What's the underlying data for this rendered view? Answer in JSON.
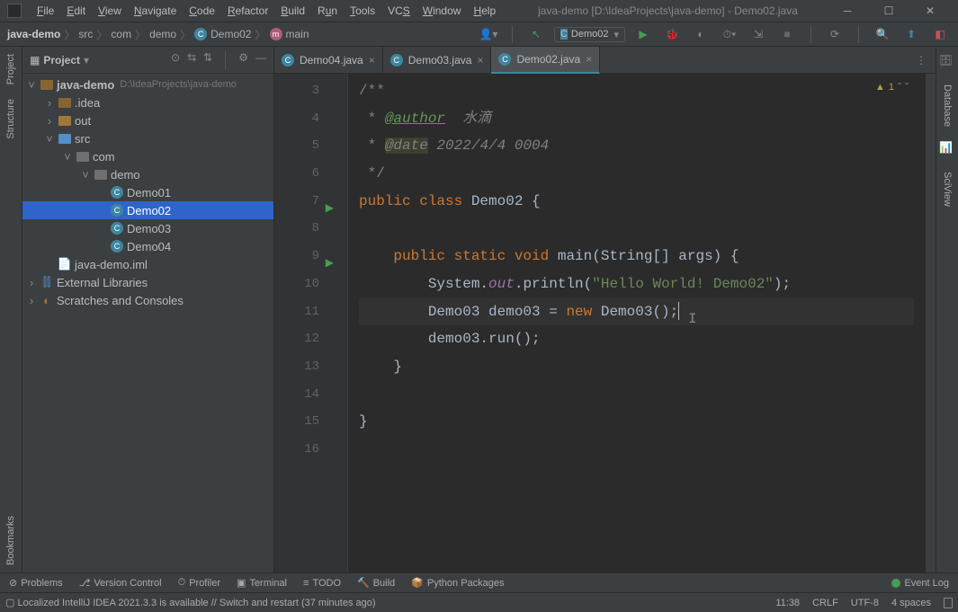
{
  "titlebar": {
    "menus": [
      "File",
      "Edit",
      "View",
      "Navigate",
      "Code",
      "Refactor",
      "Build",
      "Run",
      "Tools",
      "VCS",
      "Window",
      "Help"
    ],
    "title": "java-demo [D:\\IdeaProjects\\java-demo] - Demo02.java"
  },
  "breadcrumb": {
    "items": [
      "java-demo",
      "src",
      "com",
      "demo",
      "Demo02",
      "main"
    ]
  },
  "runConfig": "Demo02",
  "project": {
    "title": "Project",
    "root": {
      "name": "java-demo",
      "path": "D:\\IdeaProjects\\java-demo"
    },
    "idea": ".idea",
    "out": "out",
    "src": "src",
    "com": "com",
    "demo": "demo",
    "classes": [
      "Demo01",
      "Demo02",
      "Demo03",
      "Demo04"
    ],
    "iml": "java-demo.iml",
    "extlib": "External Libraries",
    "scratch": "Scratches and Consoles"
  },
  "editor": {
    "tabs": [
      {
        "name": "Demo04.java",
        "active": false
      },
      {
        "name": "Demo03.java",
        "active": false
      },
      {
        "name": "Demo02.java",
        "active": true
      }
    ],
    "startLine": 3,
    "warningCount": "1",
    "code": {
      "l3": "/**",
      "l4_tag": "@author",
      "l4_txt": "  水滴",
      "l5_tag": "@date",
      "l5_txt": " 2022/4/4 0004",
      "l6": " */",
      "l7_pub": "public ",
      "l7_cls": "class ",
      "l7_name": "Demo02 {",
      "l9a": "    public static void ",
      "l9b": "main",
      "l9c": "(String[] args) {",
      "l10a": "        System.",
      "l10b": "out",
      "l10c": ".println(",
      "l10d": "\"Hello World! Demo02\"",
      "l10e": ");",
      "l11a": "        Demo03 demo03 = ",
      "l11b": "new ",
      "l11c": "Demo03();",
      "l12": "        demo03.run();",
      "l13": "    }",
      "l15": "}"
    }
  },
  "toolWindows": {
    "left": [
      "Project",
      "Structure",
      "Bookmarks"
    ],
    "right": [
      "Database",
      "SciView"
    ],
    "bottom": [
      "Problems",
      "Version Control",
      "Profiler",
      "Terminal",
      "TODO",
      "Build",
      "Python Packages",
      "Event Log"
    ]
  },
  "status": {
    "msg": "Localized IntelliJ IDEA 2021.3.3 is available // Switch and restart (37 minutes ago)",
    "time": "11:38",
    "lineEnd": "CRLF",
    "encoding": "UTF-8",
    "indent": "4 spaces"
  }
}
